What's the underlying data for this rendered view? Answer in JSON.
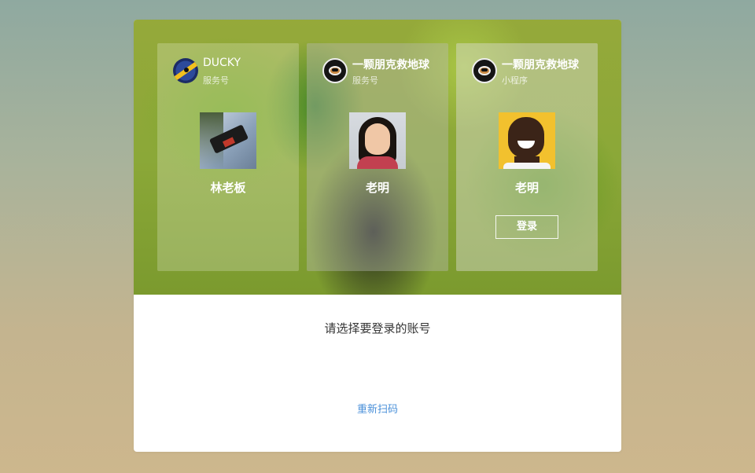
{
  "accounts": [
    {
      "account_name": "DUCKY",
      "account_type": "服务号",
      "logo_icon": "ducky-logo-icon",
      "user_name": "林老板",
      "avatar_icon": "kite-photo-avatar"
    },
    {
      "account_name": "一颗朋克救地球",
      "account_type": "服务号",
      "logo_icon": "punk-club-logo-icon",
      "user_name": "老明",
      "avatar_icon": "woman-portrait-avatar"
    },
    {
      "account_name": "一颗朋克救地球",
      "account_type": "小程序",
      "logo_icon": "punk-club-logo-icon",
      "user_name": "老明",
      "avatar_icon": "smiling-man-avatar",
      "login_label": "登录"
    }
  ],
  "prompt": "请选择要登录的账号",
  "rescan_label": "重新扫码",
  "colors": {
    "link": "#4a90d9",
    "hero_green": "#8ba838",
    "panel_bg": "#ffffff"
  }
}
